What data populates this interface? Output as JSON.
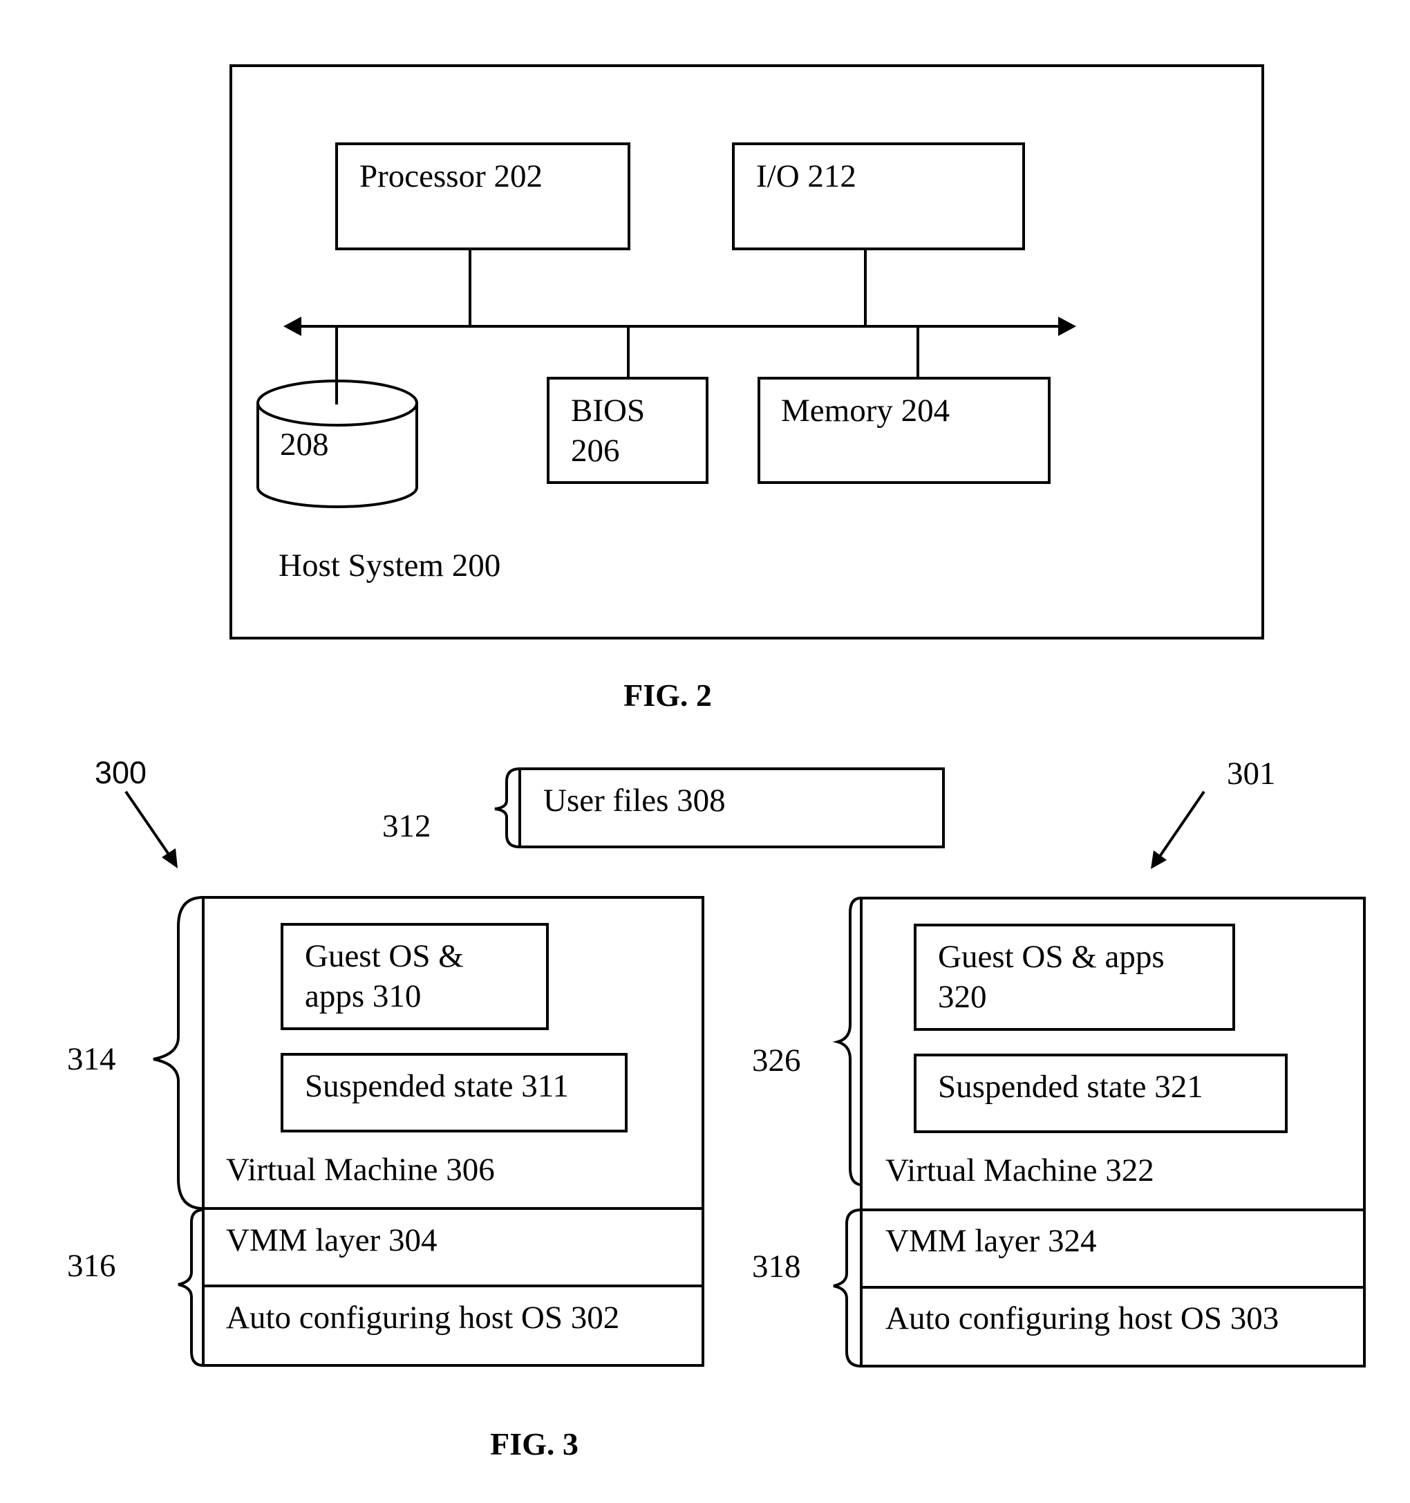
{
  "fig2": {
    "caption": "FIG. 2",
    "host_system": "Host System 200",
    "processor": "Processor 202",
    "io": "I/O 212",
    "bios_line1": "BIOS",
    "bios_line2": "206",
    "memory": "Memory 204",
    "disk": "208"
  },
  "fig3": {
    "caption": "FIG. 3",
    "ref_300": "300",
    "ref_301": "301",
    "ref_312": "312",
    "ref_314": "314",
    "ref_316": "316",
    "ref_326": "326",
    "ref_318": "318",
    "user_files": "User files 308",
    "left": {
      "guest_line1": "Guest OS &",
      "guest_line2": "apps 310",
      "suspended": "Suspended state 311",
      "vm": "Virtual Machine 306",
      "vmm": "VMM layer 304",
      "host_os": "Auto configuring host OS 302"
    },
    "right": {
      "guest_line1": "Guest OS & apps",
      "guest_line2": "320",
      "suspended": "Suspended state 321",
      "vm": "Virtual Machine 322",
      "vmm": "VMM layer 324",
      "host_os": "Auto configuring host OS 303"
    }
  }
}
